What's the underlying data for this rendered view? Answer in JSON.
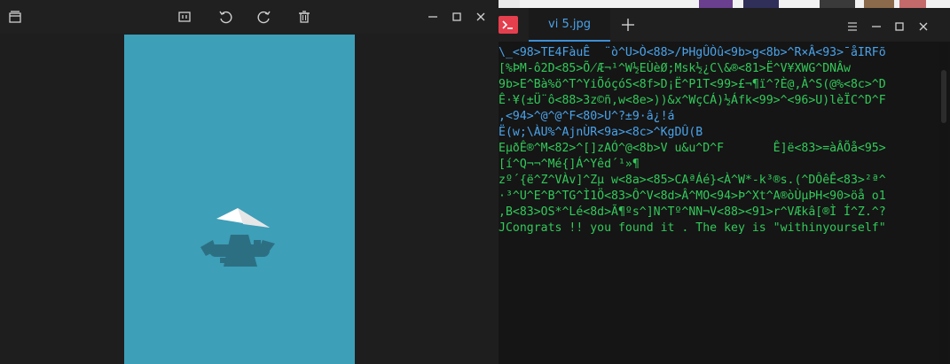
{
  "viewer": {
    "toolbar_icons": [
      "gallery-icon",
      "crop-icon",
      "rotate-left-icon",
      "rotate-right-icon",
      "delete-icon"
    ],
    "window_controls": [
      "minimize-icon",
      "maximize-icon",
      "close-icon"
    ],
    "image": {
      "background": "#3d9fb8",
      "plane": "#ffffff",
      "shadow": "#2d6f82"
    }
  },
  "terminal": {
    "tab_title": "vi 5.jpg",
    "add_tab_icon": "plus-icon",
    "menu_icon": "hamburger-icon",
    "window_controls": [
      "minimize-icon",
      "maximize-icon",
      "close-icon"
    ],
    "lines": [
      {
        "color": "#4aa3ea",
        "text": "\\_<98>TE4FàuÊ  ¨ò^U>Ò<88>/ÞHgÛÒû<9b>g<8b>^R×Â<93>¯åIRFõ"
      },
      {
        "color": "#33c95a",
        "text": "[%ÞM-ô2D<85>Õ̸Æ¬¹^W½EÙèØ;Msk½¿C\\&®<81>Ë^V¥XWG^DNÂw"
      },
      {
        "color": "#33c95a",
        "text": "9b>E^Bà%ö^T^YiÕóçóS<8f>D¡Ë^P1T<99>£¬¶ï^?È@,À^S(@%<8c>^D"
      },
      {
        "color": "#33c95a",
        "text": "Ê·¥(±Ü¨ô<88>3z©ñ,w<8e>))&x^WçCÁ)½Áfk<99>^<96>U)lèÏC^D^F"
      },
      {
        "color": "#4aa3ea",
        "text": ",<94>^@^@^F<80>U^?±9·â¿!á"
      },
      {
        "color": "#4aa3ea",
        "text": "Ë(w;\\ÀU%^AjnÙR<9a><8c>^KgDÛ(B"
      },
      {
        "color": "#33c95a",
        "text": "EµðÊ®^M<82>^[]zAÓ^@<8b>V u&u^D^F       Ê]ë<83>=àÂÕå<95>"
      },
      {
        "color": "#33c95a",
        "text": "[í^Q¬¬^Mé{]Á^Yêd´¹»¶"
      },
      {
        "color": "#33c95a",
        "text": "zº´{ë^Z^VÀv]^Zµ w<8a><85>CAªÁé}<À^W*-k³®s.(^DÔêÊ<83>²ª^"
      },
      {
        "color": "#33c95a",
        "text": "·³^U^E^B^TG^Ì1Ö<83>Ô^V<8d>Â^MO<94>Þ^Xt^A®òÙµÞH<90>öå o1"
      },
      {
        "color": "#33c95a",
        "text": ",B<83>OS*^Lé<8d>Ã¶ºs^]N^Tº^NN¬V<88><91>r^VÆkâ[®Ì Í^Z.^?"
      },
      {
        "color": "#33c95a",
        "text": "JCongrats !! you found it . The key is \"withinyourself\""
      }
    ]
  },
  "colors": {
    "accent": "#3d8fd6",
    "terminal_green": "#33c95a",
    "terminal_blue": "#4aa3ea",
    "terminal_icon": "#e53f4e"
  }
}
